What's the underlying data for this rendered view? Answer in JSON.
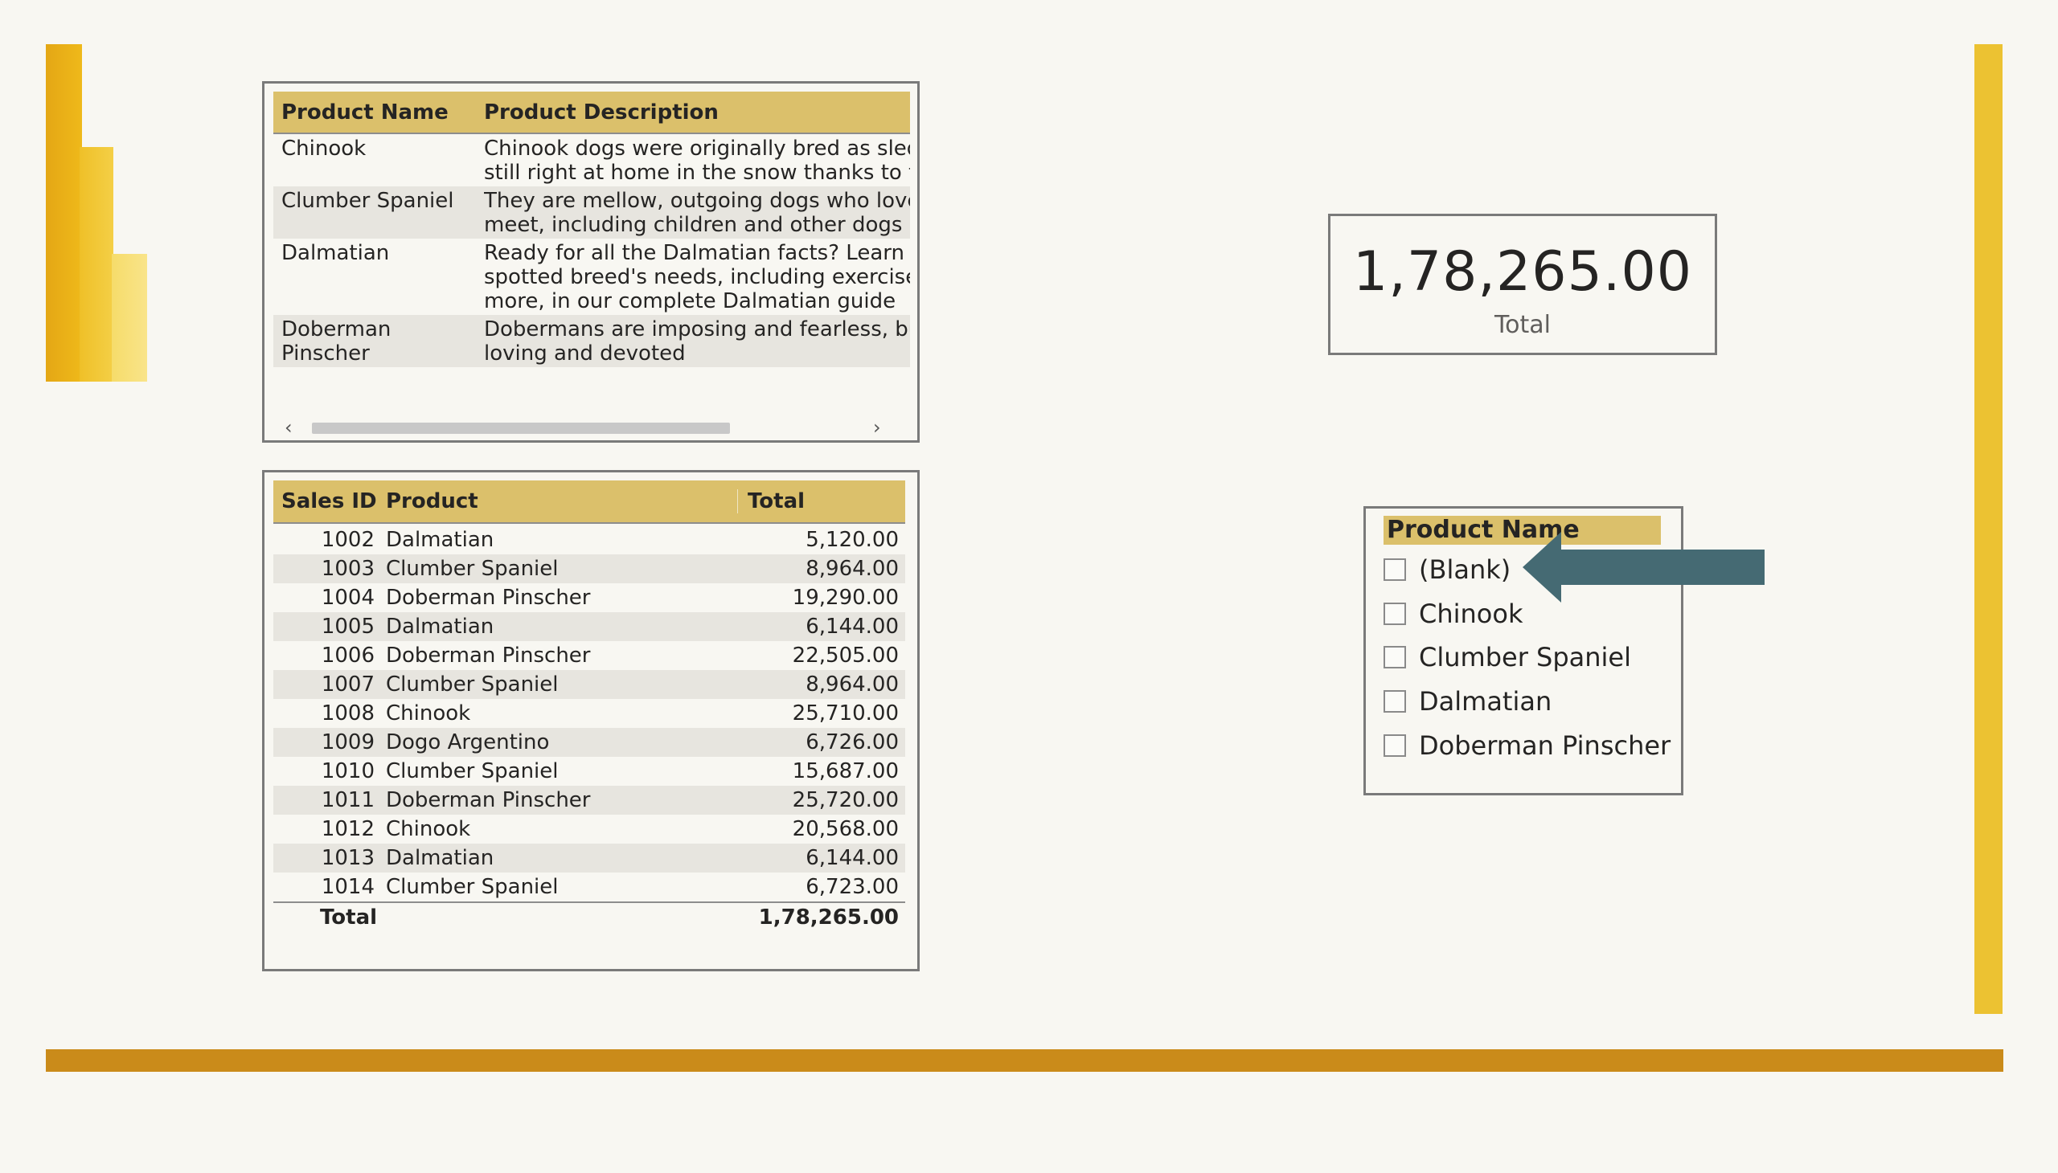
{
  "colors": {
    "background": "#f8f7f2",
    "header_gold": "#dbc06b",
    "accent_yellow": "#ecc232",
    "accent_orange": "#ca8b1a",
    "arrow_teal": "#456a73"
  },
  "product_table": {
    "headers": [
      "Product Name",
      "Product Description"
    ],
    "rows": [
      {
        "name": "Chinook",
        "desc": [
          "Chinook dogs were originally bred as sled",
          "still right at home in the snow thanks to t"
        ]
      },
      {
        "name": "Clumber Spaniel",
        "desc": [
          "They are mellow, outgoing dogs who love",
          "meet, including children and other dogs"
        ]
      },
      {
        "name": "Dalmatian",
        "desc": [
          "Ready for all the Dalmatian facts? Learn a",
          "spotted breed's needs, including exercise,",
          "more, in our complete Dalmatian guide"
        ]
      },
      {
        "name": "Doberman Pinscher",
        "desc": [
          "Dobermans are imposing and fearless, bu",
          "loving and devoted"
        ]
      }
    ],
    "scroll_left": "‹",
    "scroll_right": "›"
  },
  "sales_table": {
    "headers": [
      "Sales ID",
      "Product",
      "Total"
    ],
    "rows": [
      {
        "id": "1002",
        "product": "Dalmatian",
        "total": "5,120.00"
      },
      {
        "id": "1003",
        "product": "Clumber Spaniel",
        "total": "8,964.00"
      },
      {
        "id": "1004",
        "product": "Doberman Pinscher",
        "total": "19,290.00"
      },
      {
        "id": "1005",
        "product": "Dalmatian",
        "total": "6,144.00"
      },
      {
        "id": "1006",
        "product": "Doberman Pinscher",
        "total": "22,505.00"
      },
      {
        "id": "1007",
        "product": "Clumber Spaniel",
        "total": "8,964.00"
      },
      {
        "id": "1008",
        "product": "Chinook",
        "total": "25,710.00"
      },
      {
        "id": "1009",
        "product": "Dogo Argentino",
        "total": "6,726.00"
      },
      {
        "id": "1010",
        "product": "Clumber Spaniel",
        "total": "15,687.00"
      },
      {
        "id": "1011",
        "product": "Doberman Pinscher",
        "total": "25,720.00"
      },
      {
        "id": "1012",
        "product": "Chinook",
        "total": "20,568.00"
      },
      {
        "id": "1013",
        "product": "Dalmatian",
        "total": "6,144.00"
      },
      {
        "id": "1014",
        "product": "Clumber Spaniel",
        "total": "6,723.00"
      }
    ],
    "total_label": "Total",
    "total_value": "1,78,265.00"
  },
  "card": {
    "value": "1,78,265.00",
    "label": "Total"
  },
  "slicer": {
    "title": "Product Name",
    "items": [
      "(Blank)",
      "Chinook",
      "Clumber Spaniel",
      "Dalmatian",
      "Doberman Pinscher"
    ]
  }
}
